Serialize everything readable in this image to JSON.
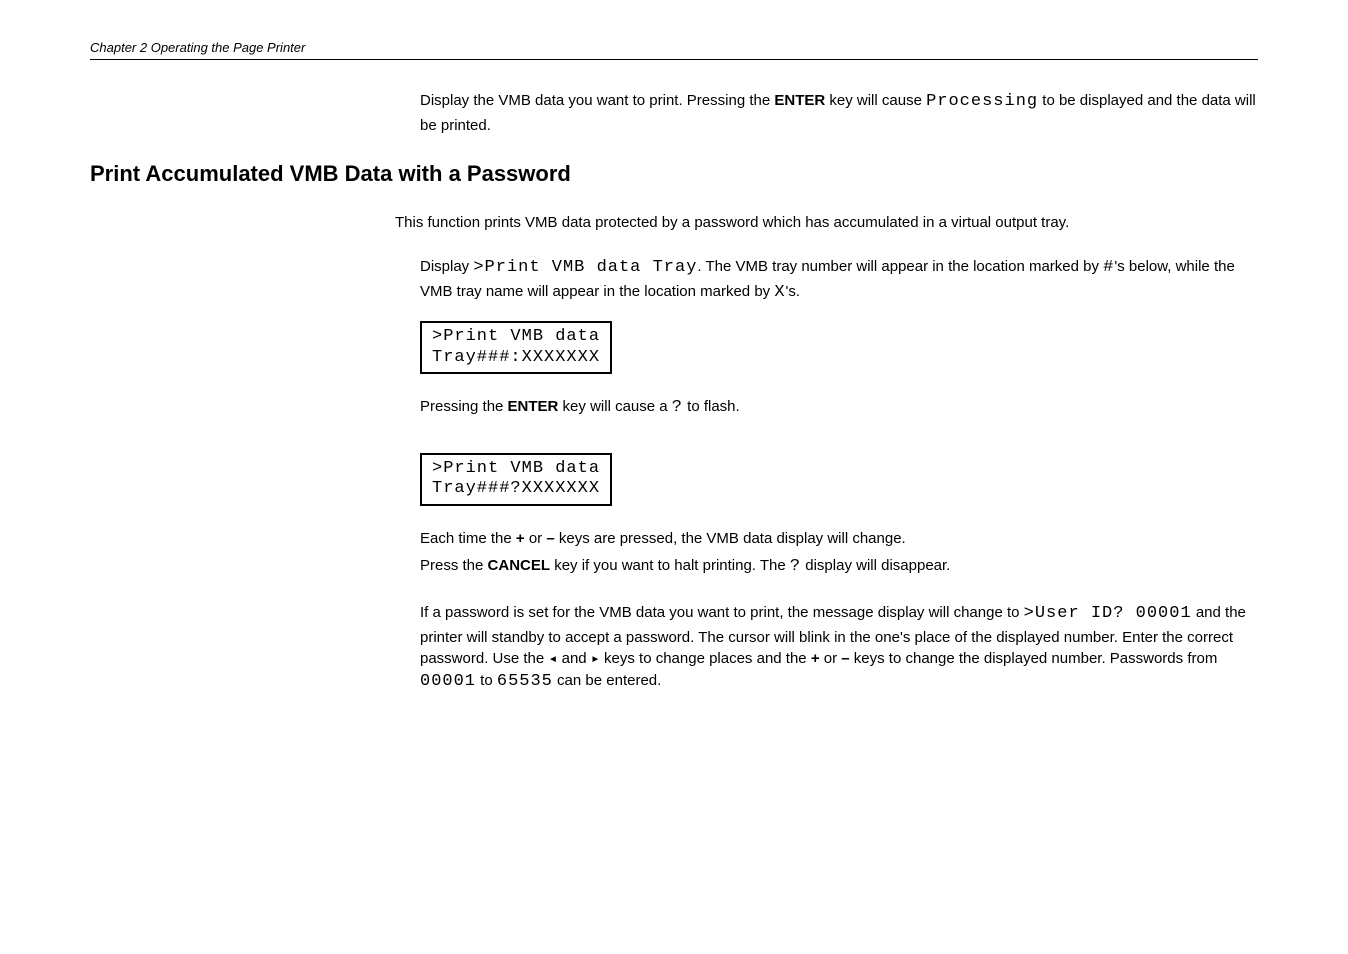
{
  "chapter_header": "Chapter 2  Operating the Page Printer",
  "intro": {
    "part1": "Display the VMB data you want to print. Pressing the ",
    "enter": "ENTER",
    "part2": " key will cause ",
    "processing": "Processing",
    "part3": " to be displayed and the data will be printed."
  },
  "section_title": "Print Accumulated VMB Data with a Password",
  "lead": "This function prints VMB data protected by a password which has accumulated in a virtual output tray.",
  "step_display": {
    "part1": "Display ",
    "cmd": ">Print VMB data Tray",
    "part2": ". The VMB tray number will appear in the location marked by ",
    "hash": "#",
    "part3": "'s below, while the VMB tray name will appear in the location marked by ",
    "x": "X",
    "part4": "'s."
  },
  "lcd1_line1": ">Print VMB data",
  "lcd1_line2": "Tray###:XXXXXXX",
  "press_enter": {
    "part1": "Pressing the ",
    "enter": "ENTER",
    "part2": " key will cause a ",
    "q": "?",
    "part3": " to flash."
  },
  "lcd2_line1": ">Print VMB data",
  "lcd2_line2": "Tray###?XXXXXXX",
  "each_time": {
    "part1": "Each time the ",
    "plus": "+",
    "part2": " or ",
    "minus": "–",
    "part3": " keys are pressed, the VMB data display will change."
  },
  "press_cancel": {
    "part1": "Press the ",
    "cancel": "CANCEL",
    "part2": " key if you want to halt printing. The ",
    "q": "?",
    "part3": " display will disappear."
  },
  "password": {
    "part1": "If a password is set for the VMB data you want to print, the message display will change to ",
    "userid": ">User ID? 00001",
    "part2": " and the printer will standby to accept a password. The cursor will blink in the one's place of the displayed number. Enter the correct password. Use the ",
    "left": "◂",
    "and": " and ",
    "right": "▸",
    "part3": " keys to change places and the ",
    "plus": "+",
    "or": " or ",
    "minus": "–",
    "part4": " keys to change the displayed number. Passwords from ",
    "pw_from": "00001",
    "to": " to ",
    "pw_to": "65535",
    "part5": " can be entered."
  }
}
